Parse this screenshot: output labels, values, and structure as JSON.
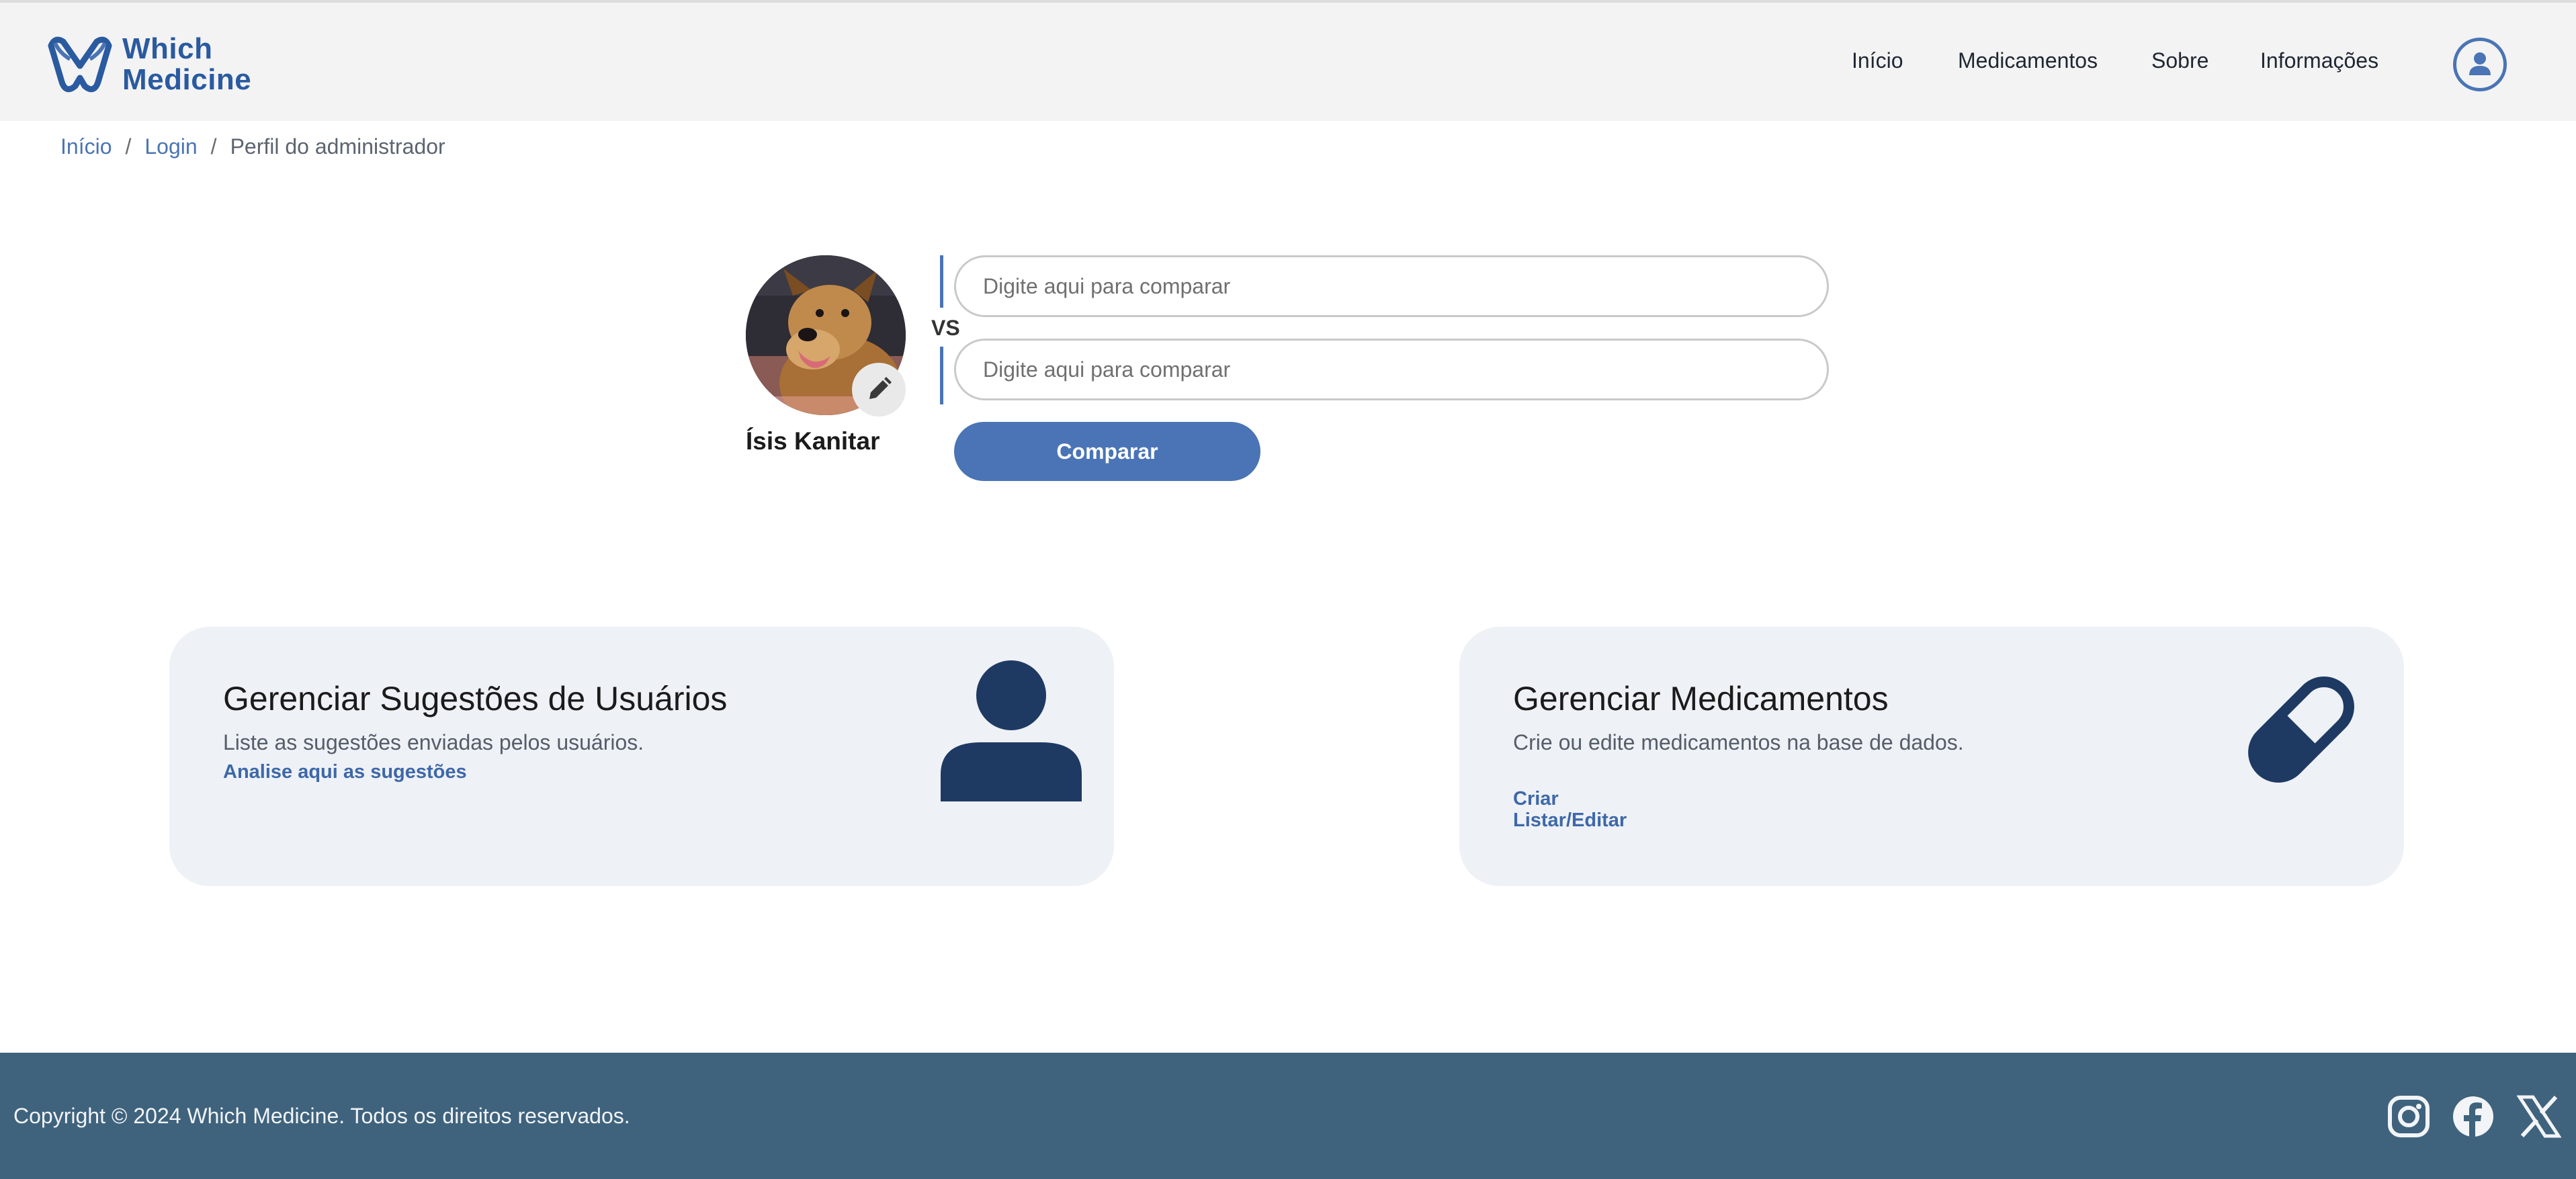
{
  "app": {
    "logo_line1": "Which",
    "logo_line2": "Medicine"
  },
  "nav": {
    "items": [
      {
        "label": "Início"
      },
      {
        "label": "Medicamentos"
      },
      {
        "label": "Sobre"
      },
      {
        "label": "Informações"
      }
    ],
    "user_icon": "user-circle-icon"
  },
  "breadcrumb": {
    "items": [
      "Início",
      "Login"
    ],
    "current": "Perfil do administrador",
    "separator": "/"
  },
  "profile": {
    "name": "Ísis Kanitar",
    "avatar_icon": "dog-photo",
    "edit_icon": "pencil-icon"
  },
  "compare": {
    "vs_label": "VS",
    "input1_placeholder": "Digite aqui para comparar",
    "input2_placeholder": "Digite aqui para comparar",
    "button_label": "Comparar"
  },
  "cards": [
    {
      "title": "Gerenciar Sugestões de Usuários",
      "description": "Liste as sugestões enviadas pelos usuários.",
      "links": [
        "Analise aqui as sugestões"
      ],
      "icon": "user-icon"
    },
    {
      "title": "Gerenciar Medicamentos",
      "description": "Crie ou edite medicamentos na base de dados.",
      "links": [
        "Criar",
        "Listar/Editar"
      ],
      "icon": "pill-icon"
    }
  ],
  "footer": {
    "copyright": "Copyright © 2024 Which Medicine. Todos os direitos reservados.",
    "social": [
      "instagram-icon",
      "facebook-icon",
      "x-icon"
    ]
  },
  "colors": {
    "brand": "#2a5aa0",
    "accent": "#4a74b5",
    "card_bg": "#eef1f6",
    "card_icon": "#1e3a63",
    "footer_bg": "#3f637d"
  }
}
